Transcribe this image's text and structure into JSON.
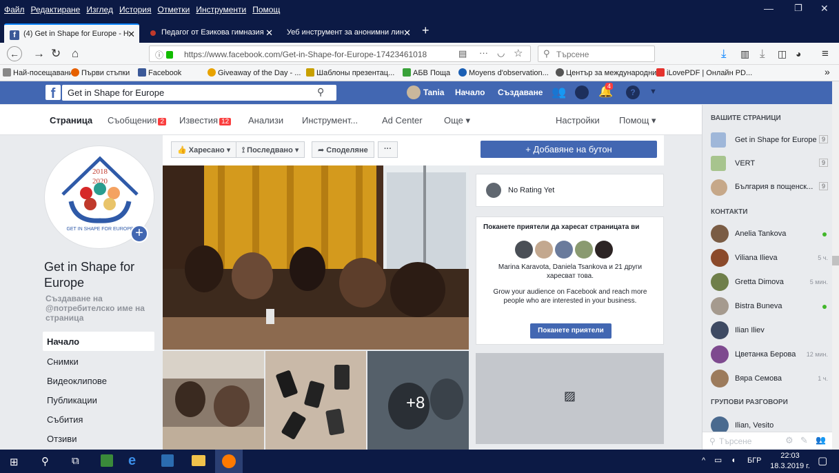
{
  "firefox": {
    "menu": [
      "Файл",
      "Редактиране",
      "Изглед",
      "История",
      "Отметки",
      "Инструменти",
      "Помощ"
    ],
    "tabs": [
      {
        "label": "(4) Get in Shape for Europe - H",
        "active": true
      },
      {
        "label": "Педагог от Езикова гимназия",
        "active": false
      },
      {
        "label": "Уеб инструмент за анонимни лин",
        "active": false
      }
    ],
    "new_tab": "+",
    "url": "https://www.facebook.com/Get-in-Shape-for-Europe-17423461018",
    "url_domain": "facebook.com",
    "search_placeholder": "Търсене",
    "bookmarks": [
      {
        "label": "Най-посещавани",
        "color": "#888888"
      },
      {
        "label": "Първи стъпки",
        "color": "#e66000"
      },
      {
        "label": "Facebook",
        "color": "#3b5998"
      },
      {
        "label": "Giveaway of the Day - ...",
        "color": "#e8a300"
      },
      {
        "label": "Шаблоны презентац...",
        "color": "#c8a000"
      },
      {
        "label": "АБВ Поща",
        "color": "#3aa23a"
      },
      {
        "label": "Moyens d'observation...",
        "color": "#1a5fb4"
      },
      {
        "label": "Център за международни...",
        "color": "#555555"
      },
      {
        "label": "iLovePDF | Онлайн PD...",
        "color": "#e5322d"
      }
    ],
    "bookmarks_overflow": "»"
  },
  "fb": {
    "logo": "f",
    "search_value": "Get in Shape for Europe",
    "user": "Tania",
    "nav_home": "Начало",
    "nav_create": "Създаване",
    "notif_count": "4",
    "page_tabs": [
      {
        "label": "Страница",
        "badge": ""
      },
      {
        "label": "Съобщения",
        "badge": "2"
      },
      {
        "label": "Известия",
        "badge": "12"
      },
      {
        "label": "Анализи",
        "badge": ""
      },
      {
        "label": "Инструмент...",
        "badge": ""
      },
      {
        "label": "Ad Center",
        "badge": ""
      },
      {
        "label": "Още ▾",
        "badge": ""
      },
      {
        "label": "Настройки",
        "badge": ""
      },
      {
        "label": "Помощ ▾",
        "badge": ""
      }
    ],
    "page": {
      "logo_years_1": "2018",
      "logo_years_2": "2020",
      "logo_ring_text": "GET IN SHAPE FOR EUROPE",
      "name": "Get in Shape for Europe",
      "username_prompt": "Създаване на @потребителско име на страница",
      "left_nav": [
        "Начало",
        "Снимки",
        "Видеоклипове",
        "Публикации",
        "Събития",
        "Отзиви"
      ]
    },
    "actions": {
      "like": "Харесано ▾",
      "follow": "Последвано ▾",
      "share": "Споделяне",
      "more": "···"
    },
    "photo_more": "+8",
    "add_button": "+ Добавяне на бутон",
    "rating": "No Rating Yet",
    "invite": {
      "title": "Поканете приятели да харесат страницата ви",
      "liked_by": "Marina Karavota, Daniela Tsankova и 21 други харесват това.",
      "grow": "Grow your audience on Facebook and reach more people who are interested in your business.",
      "button": "Поканете приятели"
    },
    "sidebar": {
      "pages_head": "ВАШИТЕ СТРАНИЦИ",
      "pages": [
        {
          "name": "Get in Shape for Europe",
          "count": "9",
          "color": "#9fb7d9"
        },
        {
          "name": "VERT",
          "count": "9",
          "color": "#a7c48e"
        },
        {
          "name": "България в пощенск...",
          "count": "9",
          "color": "#c6a889"
        }
      ],
      "contacts_head": "КОНТАКТИ",
      "contacts": [
        {
          "name": "Anelia Tankova",
          "meta": "",
          "online": true,
          "color": "#7a5c44"
        },
        {
          "name": "Viliana Ilieva",
          "meta": "5 ч.",
          "online": false,
          "color": "#8b4a2b"
        },
        {
          "name": "Gretta Dimova",
          "meta": "5 мин.",
          "online": false,
          "color": "#6f7f4a"
        },
        {
          "name": "Bistra Buneva",
          "meta": "",
          "online": true,
          "color": "#a59a8e"
        },
        {
          "name": "Ilian Iliev",
          "meta": "",
          "online": false,
          "color": "#3e4a63"
        },
        {
          "name": "Цветанка Берова",
          "meta": "12 мин.",
          "online": false,
          "color": "#7e4a8f"
        },
        {
          "name": "Вяра Семова",
          "meta": "1 ч.",
          "online": false,
          "color": "#9c7b5c"
        }
      ],
      "groups_head": "ГРУПОВИ РАЗГОВОРИ",
      "groups": [
        {
          "name": "Ilian, Vesito",
          "color": "#4a6a8f"
        }
      ],
      "search_placeholder": "Търсене"
    }
  },
  "taskbar": {
    "lang": "БГР",
    "time": "22:03",
    "date": "18.3.2019 г."
  }
}
